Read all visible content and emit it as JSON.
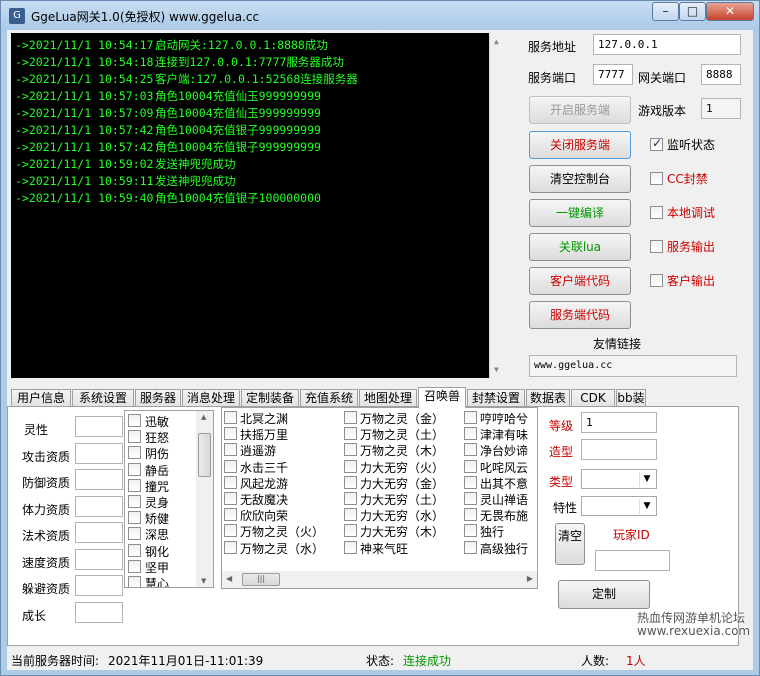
{
  "window": {
    "title": "GgeLua网关1.0(免授权) www.ggelua.cc",
    "icon": "app-icon",
    "minimize_label": "–",
    "maximize_label": "□",
    "close_label": "✕"
  },
  "console": {
    "lines": [
      {
        "time": "->2021/11/1 10:54:17",
        "msg": "启动网关:127.0.0.1:8888成功"
      },
      {
        "time": "->2021/11/1 10:54:18",
        "msg": "连接到127.0.0.1:7777服务器成功"
      },
      {
        "time": "->2021/11/1 10:54:25",
        "msg": "客户端:127.0.0.1:52568连接服务器"
      },
      {
        "time": "->2021/11/1 10:57:03",
        "msg": "角色10004充值仙玉999999999"
      },
      {
        "time": "->2021/11/1 10:57:09",
        "msg": "角色10004充值仙玉999999999"
      },
      {
        "time": "->2021/11/1 10:57:42",
        "msg": "角色10004充值银子999999999"
      },
      {
        "time": "->2021/11/1 10:57:42",
        "msg": "角色10004充值银子999999999"
      },
      {
        "time": "->2021/11/1 10:59:02",
        "msg": "发送神兜兜成功"
      },
      {
        "time": "->2021/11/1 10:59:11",
        "msg": "发送神兜兜成功"
      },
      {
        "time": "->2021/11/1 10:59:40",
        "msg": "角色10004充值银子100000000"
      }
    ]
  },
  "server": {
    "address_label": "服务地址",
    "address_value": "127.0.0.1",
    "port_label": "服务端口",
    "port_value": "7777",
    "gateway_port_label": "网关端口",
    "gateway_port_value": "8888",
    "version_label": "游戏版本",
    "version_value": "1"
  },
  "buttons": {
    "start": "开启服务端",
    "stop": "关闭服务端",
    "clear": "清空控制台",
    "compile": "一键编译",
    "lua": "关联lua",
    "client_code": "客户端代码",
    "server_code": "服务端代码"
  },
  "checks": {
    "listen": "监听状态",
    "cc": "CC封禁",
    "debug": "本地调试",
    "server_out": "服务输出",
    "client_out": "客户输出"
  },
  "links": {
    "label": "友情链接",
    "url": "www.ggelua.cc"
  },
  "tabs": [
    "用户信息",
    "系统设置",
    "服务器",
    "消息处理",
    "定制装备",
    "充值系统",
    "地图处理",
    "召唤兽",
    "封禁设置",
    "数据表",
    "CDK",
    "bb装"
  ],
  "active_tab": "召唤兽",
  "pet": {
    "attrs": [
      "灵性",
      "攻击资质",
      "防御资质",
      "体力资质",
      "法术资质",
      "速度资质",
      "躲避资质",
      "成长"
    ],
    "skills_small": [
      "迅敏",
      "狂怒",
      "阴伤",
      "静岳",
      "撞咒",
      "灵身",
      "矫健",
      "深思",
      "钢化",
      "坚甲",
      "慧心"
    ],
    "skills_col1": [
      "北冥之渊",
      "扶摇万里",
      "逍遥游",
      "水击三千",
      "风起龙游",
      "无敌魔决",
      "欣欣向荣",
      "万物之灵（火）",
      "万物之灵（水）"
    ],
    "skills_col2": [
      "万物之灵（金）",
      "万物之灵（土）",
      "万物之灵（木）",
      "力大无穷（火）",
      "力大无穷（金）",
      "力大无穷（土）",
      "力大无穷（水）",
      "力大无穷（木）",
      "神来气旺"
    ],
    "skills_col3": [
      "哼哼哈兮",
      "津津有味",
      "净台妙谛",
      "叱咤风云",
      "出其不意",
      "灵山禅语",
      "无畏布施",
      "独行",
      "高级独行"
    ],
    "level_label": "等级",
    "level_value": "1",
    "model_label": "造型",
    "type_label": "类型",
    "trait_label": "特性",
    "clear_button": "清空",
    "player_id_label": "玩家ID",
    "custom_button": "定制",
    "scroll_thumb": "|||"
  },
  "status": {
    "time_label": "当前服务器时间:",
    "time_value": "2021年11月01日-11:01:39",
    "state_label": "状态:",
    "state_value": "连接成功",
    "people_label": "人数:",
    "people_value": "1人"
  },
  "watermark": {
    "line1": "热血传网游单机论坛",
    "line2": "www.rexuexia.com"
  },
  "colors": {
    "console_bg": "#000000",
    "console_text": "#22ff22",
    "accent_red": "#cc0000",
    "accent_green": "#009900"
  }
}
